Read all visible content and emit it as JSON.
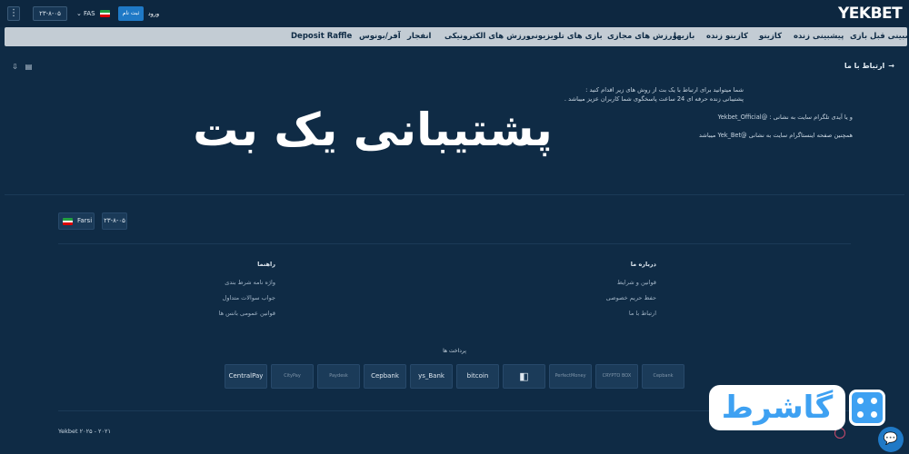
{
  "topbar": {
    "menu_icon": "kebab-icon",
    "date": "۲۳-۸-۰۵",
    "lang_code": "FAS",
    "signup_label": "ثبت نام",
    "login_label": "ورود",
    "logo": "YEKBET"
  },
  "nav": {
    "items": [
      "پیشبینی قبل بازی",
      "پیشبینی زنده",
      "کازینو",
      "کازینو زنده",
      "بازیها",
      "ورزش های مجازی",
      "بازی های تلویزیونی",
      "ورزش های الکترونیکی",
      "انفجار",
      "آفر/بونوس",
      "Deposit Raffle"
    ]
  },
  "page": {
    "print_icon": "printer-icon",
    "download_icon": "download-icon",
    "contact_title": "ارتباط با ما",
    "para_line1": "شما میتوانید برای ارتباط با یک بت از روش های زیر اقدام کنید :",
    "para_line2": "پشتیبانی زنده حرفه ای 24 ساعت پاسخگوی شما کاربران عزیز میباشد .",
    "para_line3": "و یا آیدی تلگرام سایت به نشانی : @Yekbet_Official",
    "para_line4": "همچنین صفحه اینستاگرام سایت به نشانی @Yek_Bet میباشد",
    "headline": "پشتیبانی یک بت"
  },
  "footer": {
    "lang_label": "Farsi",
    "date": "۲۳-۸-۰۵",
    "about": {
      "title": "درباره ما",
      "links": [
        "قوانین و شرایط",
        "حفظ حریم خصوصی",
        "ارتباط با ما"
      ]
    },
    "guide": {
      "title": "راهنما",
      "links": [
        "واژه نامه شرط بندی",
        "جواب سوالات متداول",
        "قوانین عمومی بانس ها"
      ]
    },
    "payments_title": "پرداخت ها",
    "payments": [
      "CentralPay",
      "CityPay",
      "Paydesk",
      "Cepbank",
      "ys_Bank",
      "bitcoin",
      "",
      "PerfectMoney",
      "CRYPTO BOX",
      "Cepbank"
    ],
    "copyright": "Yekbet ۲۰۲۵ - ۲۰۲۱"
  },
  "watermark": {
    "text": "گاشرط"
  }
}
